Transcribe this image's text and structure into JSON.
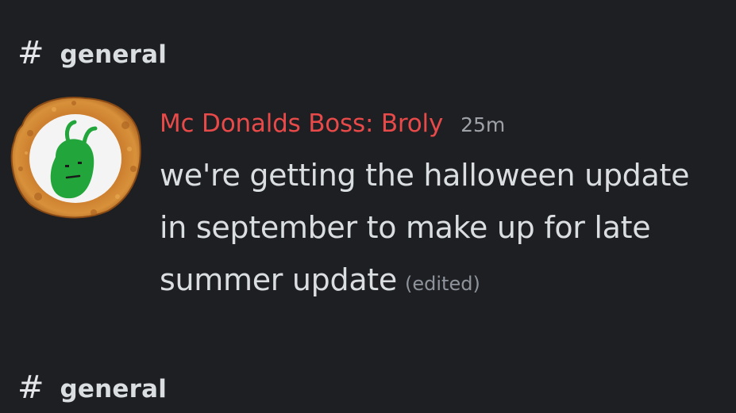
{
  "channels": {
    "top": {
      "hash": "#",
      "name": "general"
    },
    "bottom": {
      "hash": "#",
      "name": "general"
    }
  },
  "message": {
    "author": "Mc Donalds Boss: Broly",
    "timestamp": "25m",
    "lines": [
      "we're getting the halloween update",
      "in september to make up for late",
      "summer update"
    ],
    "edited_label": "(edited)"
  },
  "colors": {
    "background": "#1e1f22",
    "author": "#e84a4a",
    "text": "#dbdee1",
    "muted": "#9ea2a8"
  }
}
